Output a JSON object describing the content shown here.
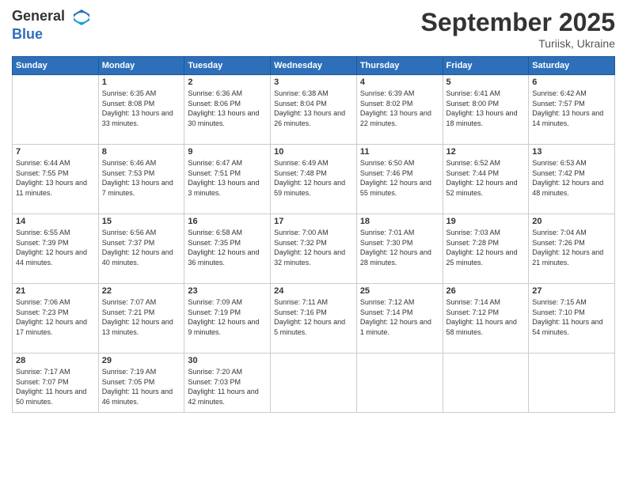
{
  "logo": {
    "general": "General",
    "blue": "Blue"
  },
  "header": {
    "month": "September 2025",
    "location": "Turiisk, Ukraine"
  },
  "days_of_week": [
    "Sunday",
    "Monday",
    "Tuesday",
    "Wednesday",
    "Thursday",
    "Friday",
    "Saturday"
  ],
  "weeks": [
    [
      {
        "day": "",
        "empty": true
      },
      {
        "day": "1",
        "sunrise": "Sunrise: 6:35 AM",
        "sunset": "Sunset: 8:08 PM",
        "daylight": "Daylight: 13 hours and 33 minutes."
      },
      {
        "day": "2",
        "sunrise": "Sunrise: 6:36 AM",
        "sunset": "Sunset: 8:06 PM",
        "daylight": "Daylight: 13 hours and 30 minutes."
      },
      {
        "day": "3",
        "sunrise": "Sunrise: 6:38 AM",
        "sunset": "Sunset: 8:04 PM",
        "daylight": "Daylight: 13 hours and 26 minutes."
      },
      {
        "day": "4",
        "sunrise": "Sunrise: 6:39 AM",
        "sunset": "Sunset: 8:02 PM",
        "daylight": "Daylight: 13 hours and 22 minutes."
      },
      {
        "day": "5",
        "sunrise": "Sunrise: 6:41 AM",
        "sunset": "Sunset: 8:00 PM",
        "daylight": "Daylight: 13 hours and 18 minutes."
      },
      {
        "day": "6",
        "sunrise": "Sunrise: 6:42 AM",
        "sunset": "Sunset: 7:57 PM",
        "daylight": "Daylight: 13 hours and 14 minutes."
      }
    ],
    [
      {
        "day": "7",
        "sunrise": "Sunrise: 6:44 AM",
        "sunset": "Sunset: 7:55 PM",
        "daylight": "Daylight: 13 hours and 11 minutes."
      },
      {
        "day": "8",
        "sunrise": "Sunrise: 6:46 AM",
        "sunset": "Sunset: 7:53 PM",
        "daylight": "Daylight: 13 hours and 7 minutes."
      },
      {
        "day": "9",
        "sunrise": "Sunrise: 6:47 AM",
        "sunset": "Sunset: 7:51 PM",
        "daylight": "Daylight: 13 hours and 3 minutes."
      },
      {
        "day": "10",
        "sunrise": "Sunrise: 6:49 AM",
        "sunset": "Sunset: 7:48 PM",
        "daylight": "Daylight: 12 hours and 59 minutes."
      },
      {
        "day": "11",
        "sunrise": "Sunrise: 6:50 AM",
        "sunset": "Sunset: 7:46 PM",
        "daylight": "Daylight: 12 hours and 55 minutes."
      },
      {
        "day": "12",
        "sunrise": "Sunrise: 6:52 AM",
        "sunset": "Sunset: 7:44 PM",
        "daylight": "Daylight: 12 hours and 52 minutes."
      },
      {
        "day": "13",
        "sunrise": "Sunrise: 6:53 AM",
        "sunset": "Sunset: 7:42 PM",
        "daylight": "Daylight: 12 hours and 48 minutes."
      }
    ],
    [
      {
        "day": "14",
        "sunrise": "Sunrise: 6:55 AM",
        "sunset": "Sunset: 7:39 PM",
        "daylight": "Daylight: 12 hours and 44 minutes."
      },
      {
        "day": "15",
        "sunrise": "Sunrise: 6:56 AM",
        "sunset": "Sunset: 7:37 PM",
        "daylight": "Daylight: 12 hours and 40 minutes."
      },
      {
        "day": "16",
        "sunrise": "Sunrise: 6:58 AM",
        "sunset": "Sunset: 7:35 PM",
        "daylight": "Daylight: 12 hours and 36 minutes."
      },
      {
        "day": "17",
        "sunrise": "Sunrise: 7:00 AM",
        "sunset": "Sunset: 7:32 PM",
        "daylight": "Daylight: 12 hours and 32 minutes."
      },
      {
        "day": "18",
        "sunrise": "Sunrise: 7:01 AM",
        "sunset": "Sunset: 7:30 PM",
        "daylight": "Daylight: 12 hours and 28 minutes."
      },
      {
        "day": "19",
        "sunrise": "Sunrise: 7:03 AM",
        "sunset": "Sunset: 7:28 PM",
        "daylight": "Daylight: 12 hours and 25 minutes."
      },
      {
        "day": "20",
        "sunrise": "Sunrise: 7:04 AM",
        "sunset": "Sunset: 7:26 PM",
        "daylight": "Daylight: 12 hours and 21 minutes."
      }
    ],
    [
      {
        "day": "21",
        "sunrise": "Sunrise: 7:06 AM",
        "sunset": "Sunset: 7:23 PM",
        "daylight": "Daylight: 12 hours and 17 minutes."
      },
      {
        "day": "22",
        "sunrise": "Sunrise: 7:07 AM",
        "sunset": "Sunset: 7:21 PM",
        "daylight": "Daylight: 12 hours and 13 minutes."
      },
      {
        "day": "23",
        "sunrise": "Sunrise: 7:09 AM",
        "sunset": "Sunset: 7:19 PM",
        "daylight": "Daylight: 12 hours and 9 minutes."
      },
      {
        "day": "24",
        "sunrise": "Sunrise: 7:11 AM",
        "sunset": "Sunset: 7:16 PM",
        "daylight": "Daylight: 12 hours and 5 minutes."
      },
      {
        "day": "25",
        "sunrise": "Sunrise: 7:12 AM",
        "sunset": "Sunset: 7:14 PM",
        "daylight": "Daylight: 12 hours and 1 minute."
      },
      {
        "day": "26",
        "sunrise": "Sunrise: 7:14 AM",
        "sunset": "Sunset: 7:12 PM",
        "daylight": "Daylight: 11 hours and 58 minutes."
      },
      {
        "day": "27",
        "sunrise": "Sunrise: 7:15 AM",
        "sunset": "Sunset: 7:10 PM",
        "daylight": "Daylight: 11 hours and 54 minutes."
      }
    ],
    [
      {
        "day": "28",
        "sunrise": "Sunrise: 7:17 AM",
        "sunset": "Sunset: 7:07 PM",
        "daylight": "Daylight: 11 hours and 50 minutes."
      },
      {
        "day": "29",
        "sunrise": "Sunrise: 7:19 AM",
        "sunset": "Sunset: 7:05 PM",
        "daylight": "Daylight: 11 hours and 46 minutes."
      },
      {
        "day": "30",
        "sunrise": "Sunrise: 7:20 AM",
        "sunset": "Sunset: 7:03 PM",
        "daylight": "Daylight: 11 hours and 42 minutes."
      },
      {
        "day": "",
        "empty": true
      },
      {
        "day": "",
        "empty": true
      },
      {
        "day": "",
        "empty": true
      },
      {
        "day": "",
        "empty": true
      }
    ]
  ]
}
